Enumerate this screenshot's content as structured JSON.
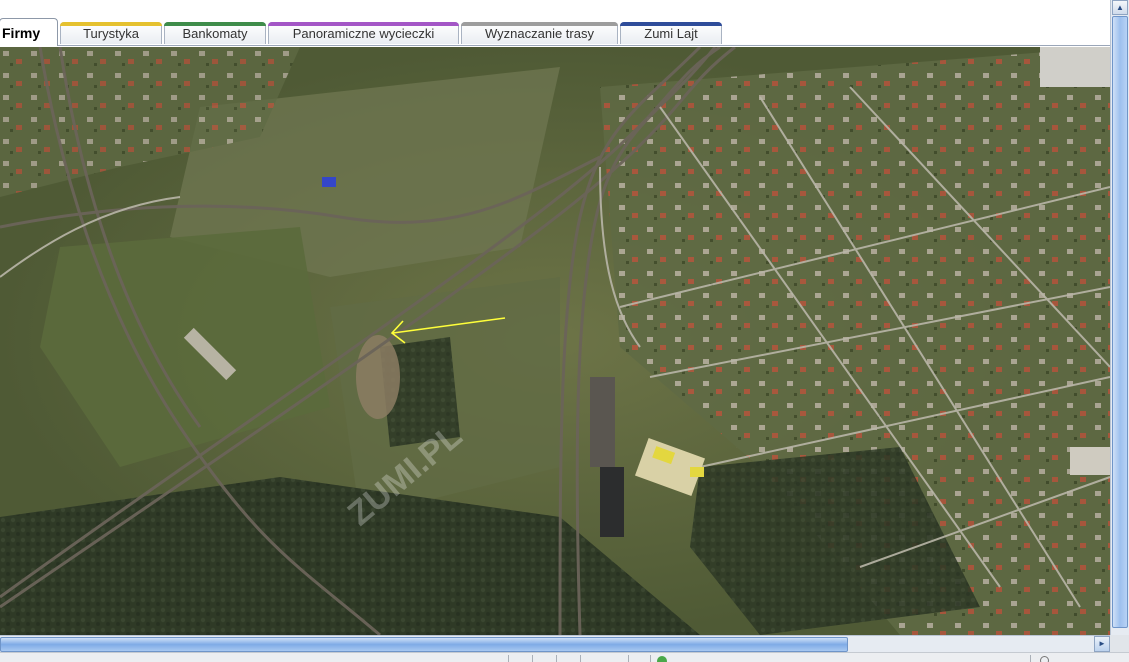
{
  "tabs": [
    {
      "label": "Firmy",
      "accent": "#3a5ea8",
      "active": true
    },
    {
      "label": "Turystyka",
      "accent": "#e5c12f"
    },
    {
      "label": "Bankomaty",
      "accent": "#3e8c4a"
    },
    {
      "label": "Panoramiczne wycieczki",
      "accent": "#a356c6"
    },
    {
      "label": "Wyznaczanie trasy",
      "accent": "#9d9d9d"
    },
    {
      "label": "Zumi Lajt",
      "accent": "#2e4c9a"
    }
  ],
  "map": {
    "watermark": "ZUMI.PL",
    "arrow_color": "#ffff3a"
  },
  "scrollbars": {
    "up_arrow": "▲",
    "right_arrow": "►"
  }
}
